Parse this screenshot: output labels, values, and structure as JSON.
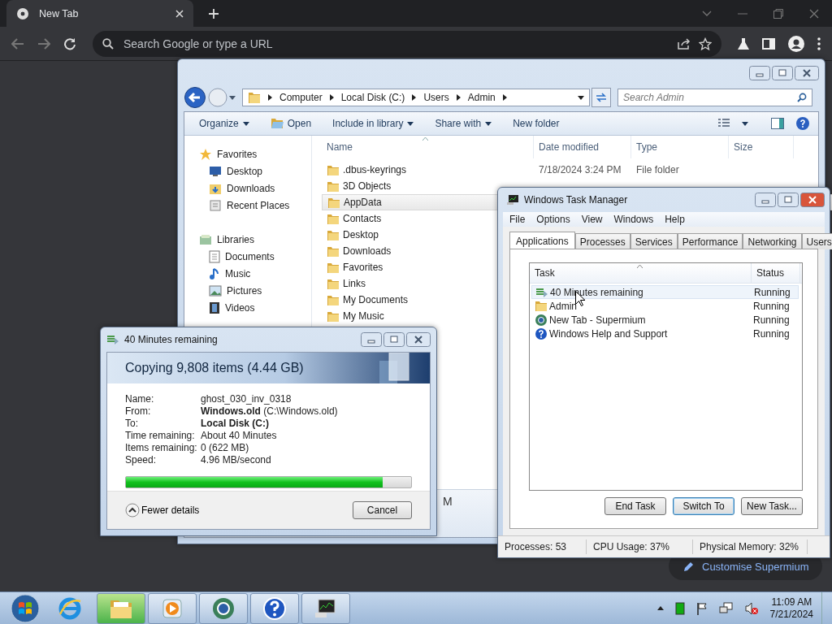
{
  "browser": {
    "tab": {
      "title": "New Tab"
    },
    "omnibox": {
      "placeholder": "Search Google or type a URL"
    },
    "customise_button": "Customise Supermium"
  },
  "explorer": {
    "breadcrumb": [
      "Computer",
      "Local Disk (C:)",
      "Users",
      "Admin"
    ],
    "search": {
      "placeholder": "Search Admin"
    },
    "toolbar": [
      {
        "label": "Organize",
        "kind": "plain",
        "dropdown": true
      },
      {
        "label": "Open",
        "kind": "open",
        "dropdown": false
      },
      {
        "label": "Include in library",
        "kind": "plain",
        "dropdown": true
      },
      {
        "label": "Share with",
        "kind": "plain",
        "dropdown": true
      },
      {
        "label": "New folder",
        "kind": "plain",
        "dropdown": false
      }
    ],
    "nav": [
      {
        "label": "Favorites",
        "kind": "favorites",
        "children": [
          {
            "label": "Desktop",
            "kind": "desktop"
          },
          {
            "label": "Downloads",
            "kind": "downloads"
          },
          {
            "label": "Recent Places",
            "kind": "recent"
          }
        ]
      },
      {
        "label": "Libraries",
        "kind": "libraries",
        "children": [
          {
            "label": "Documents",
            "kind": "documents"
          },
          {
            "label": "Music",
            "kind": "music"
          },
          {
            "label": "Pictures",
            "kind": "pictures"
          },
          {
            "label": "Videos",
            "kind": "videos"
          }
        ]
      }
    ],
    "columns": [
      "Name",
      "Date modified",
      "Type",
      "Size"
    ],
    "rows": [
      {
        "name": ".dbus-keyrings",
        "date": "7/18/2024 3:24 PM",
        "type": "File folder",
        "selected": false
      },
      {
        "name": "3D Objects",
        "selected": false
      },
      {
        "name": "AppData",
        "selected": true
      },
      {
        "name": "Contacts",
        "selected": false
      },
      {
        "name": "Desktop",
        "selected": false
      },
      {
        "name": "Downloads",
        "selected": false
      },
      {
        "name": "Favorites",
        "selected": false
      },
      {
        "name": "Links",
        "selected": false
      },
      {
        "name": "My Documents",
        "selected": false
      },
      {
        "name": "My Music",
        "selected": false
      }
    ],
    "details_fragment": "M"
  },
  "copy_dialog": {
    "title": "40 Minutes remaining",
    "heading": "Copying 9,808 items (4.44 GB)",
    "details": [
      {
        "label": "Name:",
        "value": "ghost_030_inv_0318",
        "bold": false
      },
      {
        "label": "From:",
        "value": "**Windows.old** (C:\\Windows.old)",
        "bold": false
      },
      {
        "label": "To:",
        "value": "Local Disk (C:)",
        "bold": true
      },
      {
        "label": "Time remaining:",
        "value": "About 40 Minutes",
        "bold": false
      },
      {
        "label": "Items remaining:",
        "value": "0 (622 MB)",
        "bold": false
      },
      {
        "label": "Speed:",
        "value": "4.96 MB/second",
        "bold": false
      }
    ],
    "progress": {
      "level": 0.9
    },
    "toggle": "Fewer details",
    "cancel": "Cancel"
  },
  "task_manager": {
    "title": "Windows Task Manager",
    "menu": [
      "File",
      "Options",
      "View",
      "Windows",
      "Help"
    ],
    "tabs": [
      {
        "label": "Applications",
        "selected": true
      },
      {
        "label": "Processes",
        "selected": false
      },
      {
        "label": "Services",
        "selected": false
      },
      {
        "label": "Performance",
        "selected": false
      },
      {
        "label": "Networking",
        "selected": false
      },
      {
        "label": "Users",
        "selected": false
      }
    ],
    "columns": [
      "Task",
      "Status"
    ],
    "rows": [
      {
        "task": "40 Minutes remaining",
        "status": "Running",
        "kind": "copy",
        "selected": true
      },
      {
        "task": "Admin",
        "status": "Running",
        "kind": "folder",
        "selected": false
      },
      {
        "task": "New Tab - Supermium",
        "status": "Running",
        "kind": "browser",
        "selected": false
      },
      {
        "task": "Windows Help and Support",
        "status": "Running",
        "kind": "help",
        "selected": false
      }
    ],
    "buttons": [
      {
        "label": "End Task",
        "default": false
      },
      {
        "label": "Switch To",
        "default": true
      },
      {
        "label": "New Task...",
        "default": false
      }
    ],
    "status": [
      "Processes: 53",
      "CPU Usage: 37%",
      "Physical Memory: 32%"
    ]
  },
  "taskbar": {
    "items": [
      {
        "kind": "ie",
        "running": false,
        "selected": false
      },
      {
        "kind": "explorer",
        "running": true,
        "selected": true
      },
      {
        "kind": "media",
        "running": true,
        "selected": false
      },
      {
        "kind": "browser",
        "running": true,
        "selected": false
      },
      {
        "kind": "help",
        "running": true,
        "selected": false
      },
      {
        "kind": "taskmgr",
        "running": true,
        "selected": false
      }
    ],
    "time": "11:09 AM",
    "date": "7/21/2024"
  }
}
